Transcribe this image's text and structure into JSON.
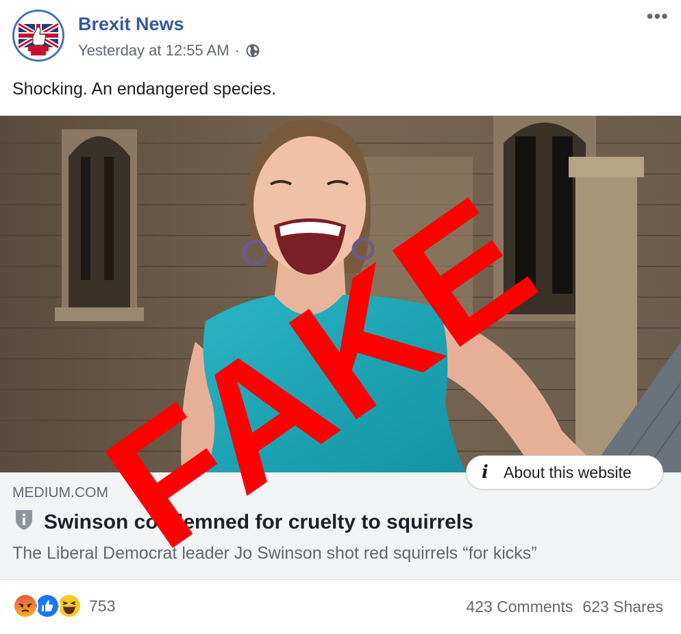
{
  "post": {
    "page_name": "Brexit News",
    "timestamp": "Yesterday at 12:55 AM",
    "separator": "·",
    "privacy_icon": "globe-icon",
    "more_icon": "ellipsis-icon",
    "more_label": "•••",
    "text": "Shocking. An endangered species.",
    "avatar_logo_text": "BREXIT NEWS"
  },
  "overlay": {
    "stamp_text": "FAKE",
    "stamp_color": "#ff0000"
  },
  "link_preview": {
    "domain": "MEDIUM.COM",
    "title": "Swinson condemned for cruelty to squirrels",
    "description": "The Liberal Democrat leader Jo Swinson shot red squirrels “for kicks”",
    "shield_icon": "shield-info-icon",
    "about_button_label": "About this website",
    "about_icon": "info-icon",
    "about_icon_glyph": "i"
  },
  "footer": {
    "reactions": [
      "angry-reaction-icon",
      "like-reaction-icon",
      "haha-reaction-icon"
    ],
    "reaction_count": "753",
    "comments": "423 Comments",
    "shares": "623 Shares"
  },
  "colors": {
    "brand_blue": "#385898",
    "meta_gray": "#606770",
    "preview_bg": "#f2f3f5",
    "dress_teal": "#1fa7b8"
  }
}
